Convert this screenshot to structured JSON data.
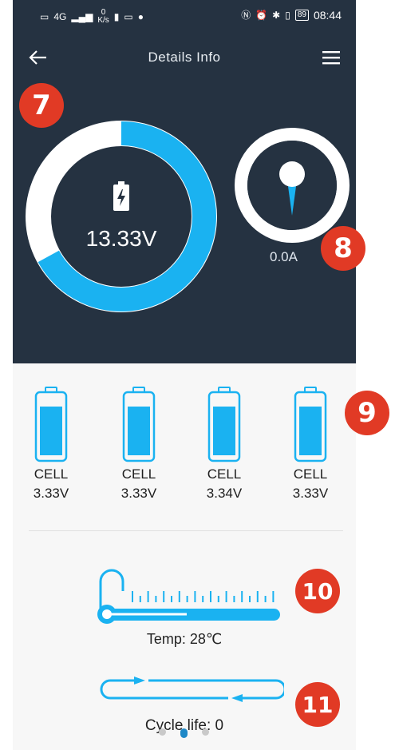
{
  "status_bar": {
    "network_type": "4G",
    "speed_value": "0",
    "speed_unit": "K/s",
    "battery_level": "89",
    "time": "08:44"
  },
  "header": {
    "title": "Details Info",
    "back_icon": "arrow-left-icon",
    "menu_icon": "hamburger-menu-icon"
  },
  "badges": {
    "voltage": "7",
    "current": "8",
    "cells": "9",
    "temperature": "10",
    "cycle": "11"
  },
  "colors": {
    "dark_bg": "#253241",
    "accent_blue": "#1ab2f1",
    "badge_red": "#e13a25",
    "ring_white": "#ffffff"
  },
  "voltage_gauge": {
    "value_text": "13.33V",
    "icon": "battery-charging-icon",
    "fill_fraction": 0.67
  },
  "current_gauge": {
    "value_text": "0.0A",
    "icon": "needle-gauge-icon"
  },
  "cells": [
    {
      "label": "CELL",
      "voltage": "3.33V",
      "fill_fraction": 0.85
    },
    {
      "label": "CELL",
      "voltage": "3.33V",
      "fill_fraction": 0.85
    },
    {
      "label": "CELL",
      "voltage": "3.34V",
      "fill_fraction": 0.85
    },
    {
      "label": "CELL",
      "voltage": "3.33V",
      "fill_fraction": 0.85
    }
  ],
  "temperature": {
    "text": "Temp: 28℃",
    "icon": "thermometer-icon"
  },
  "cycle": {
    "text": "Cycle life: 0",
    "icon": "cycle-arrows-icon"
  },
  "pager": {
    "page_count": 3,
    "active_index": 1
  }
}
